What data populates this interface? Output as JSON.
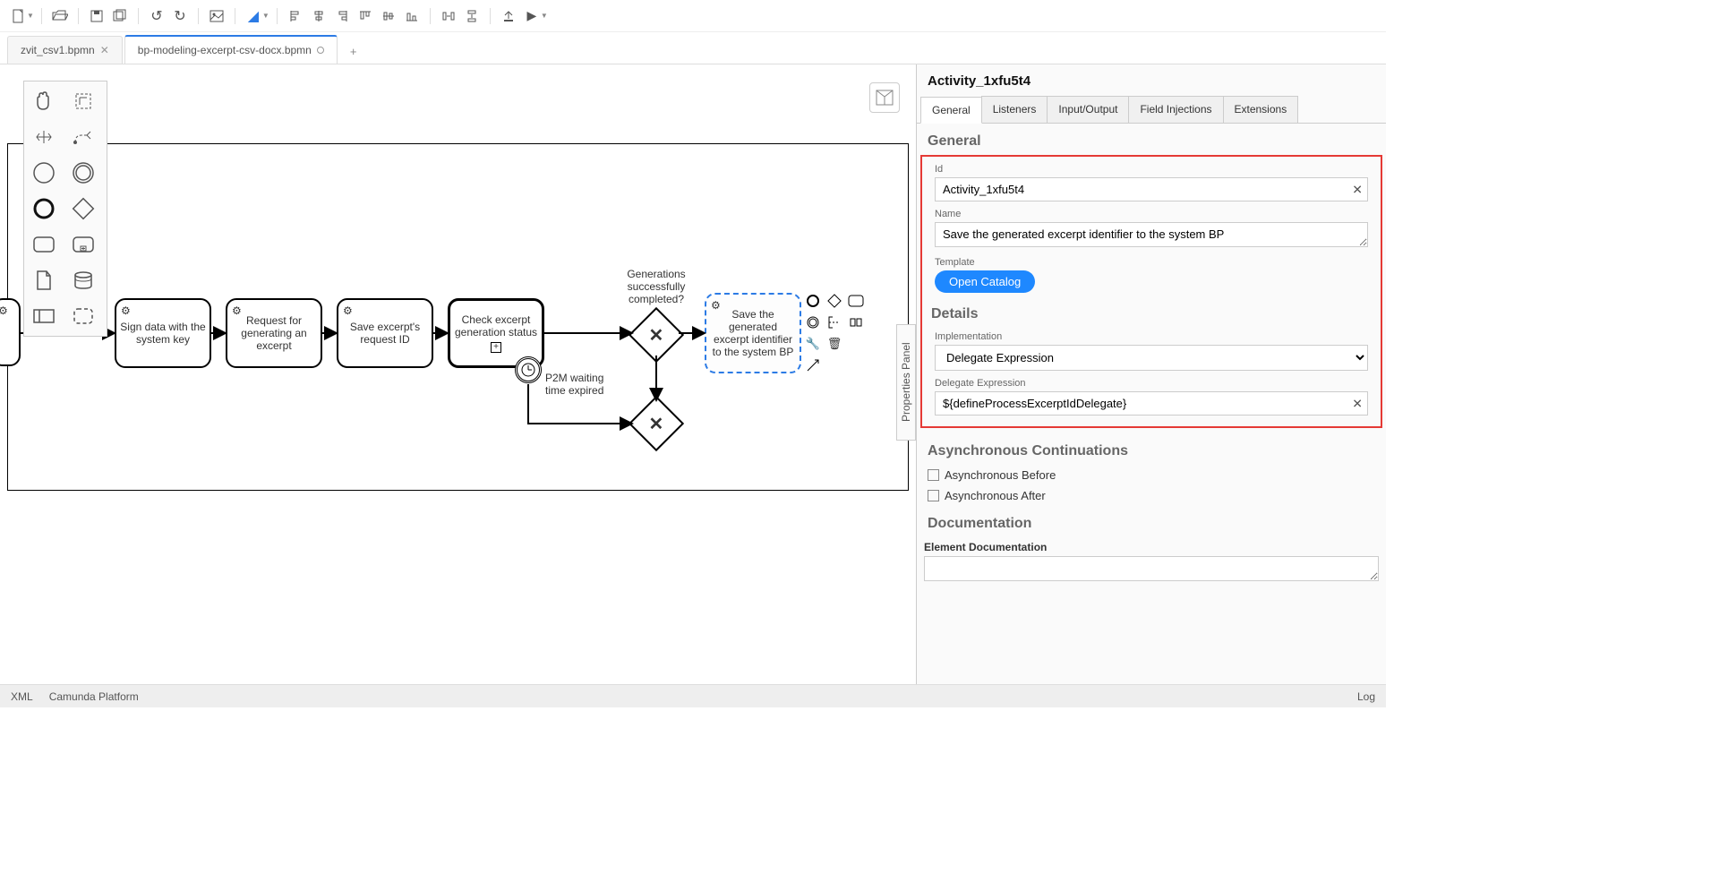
{
  "toolbar": {
    "new": "new-file",
    "open": "open",
    "save": "save",
    "saveall": "save-all",
    "undo": "undo",
    "redo": "redo",
    "image": "image",
    "marker": "marker",
    "play": "play",
    "upload": "upload"
  },
  "tabs": [
    {
      "label": "zvit_csv1.bpmn",
      "active": false,
      "dirty": false
    },
    {
      "label": "bp-modeling-excerpt-csv-docx.bpmn",
      "active": true,
      "dirty": true
    }
  ],
  "diagram": {
    "nodes": {
      "n1": "Sign data with the system key",
      "n2": "Request for generating an excerpt",
      "n3": "Save excerpt's request ID",
      "n4": "Check excerpt generation status",
      "n5": "Save the generated excerpt identifier to the system BP"
    },
    "labels": {
      "g1": "Generations successfully completed?",
      "t1": "P2M waiting time expired"
    }
  },
  "propToggle": "Properties Panel",
  "panel": {
    "header": "Activity_1xfu5t4",
    "tabs": [
      "General",
      "Listeners",
      "Input/Output",
      "Field Injections",
      "Extensions"
    ],
    "activeTab": 0,
    "sections": {
      "general": "General",
      "details": "Details",
      "async": "Asynchronous Continuations",
      "doc": "Documentation"
    },
    "fields": {
      "id_label": "Id",
      "id_value": "Activity_1xfu5t4",
      "name_label": "Name",
      "name_value": "Save the generated excerpt identifier to the system BP",
      "template_label": "Template",
      "template_btn": "Open Catalog",
      "impl_label": "Implementation",
      "impl_value": "Delegate Expression",
      "delexp_label": "Delegate Expression",
      "delexp_value": "${defineProcessExcerptIdDelegate}",
      "async_before": "Asynchronous Before",
      "async_after": "Asynchronous After",
      "eldoc": "Element Documentation"
    }
  },
  "statusbar": {
    "xml": "XML",
    "platform": "Camunda Platform",
    "log": "Log"
  }
}
